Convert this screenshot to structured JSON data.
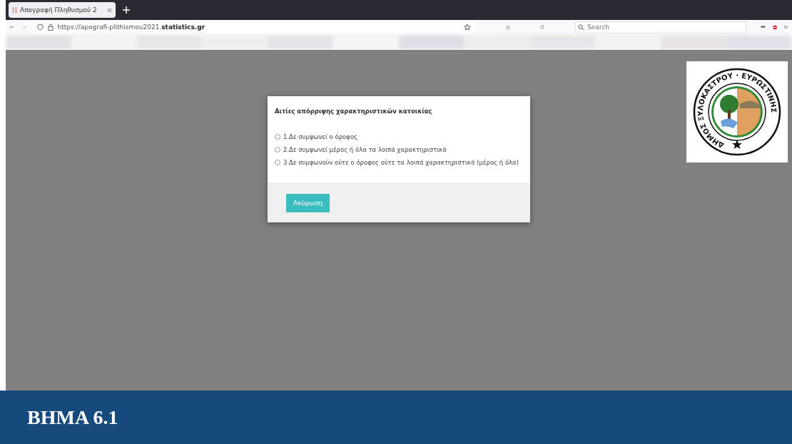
{
  "browser": {
    "tab": {
      "title": "Απογραφή Πληθυσμού 2",
      "selected": true
    },
    "url": {
      "prefix": "https://apografi-plithismou2021.",
      "domain": "statistics.gr"
    },
    "search": {
      "placeholder": "Search"
    }
  },
  "dialog": {
    "title": "Αιτίες απόρριψης χαρακτηριστικών κατοικίας",
    "options": [
      {
        "label": "1.Δε συμφωνεί ο όροφος",
        "selected": false
      },
      {
        "label": "2.Δε συμφωνεί μέρος ή όλα τα λοιπά χαρακτηριστικά",
        "selected": false
      },
      {
        "label": "3.Δε συμφωνούν ούτε ο όροφος ούτε τα λοιπά χαρακτηριστικά (μέρος ή όλα)",
        "selected": false
      }
    ],
    "buttons": [
      "Ακύρωση"
    ]
  },
  "logo": {
    "ring_text": "ΔΗΜΟΣ ΞΥΛΟΚΑΣΤΡΟΥ · ΕΥΡΩΣΤΙΝΗΣ"
  },
  "banner": {
    "title": "ΒΗΜΑ 6.1"
  }
}
